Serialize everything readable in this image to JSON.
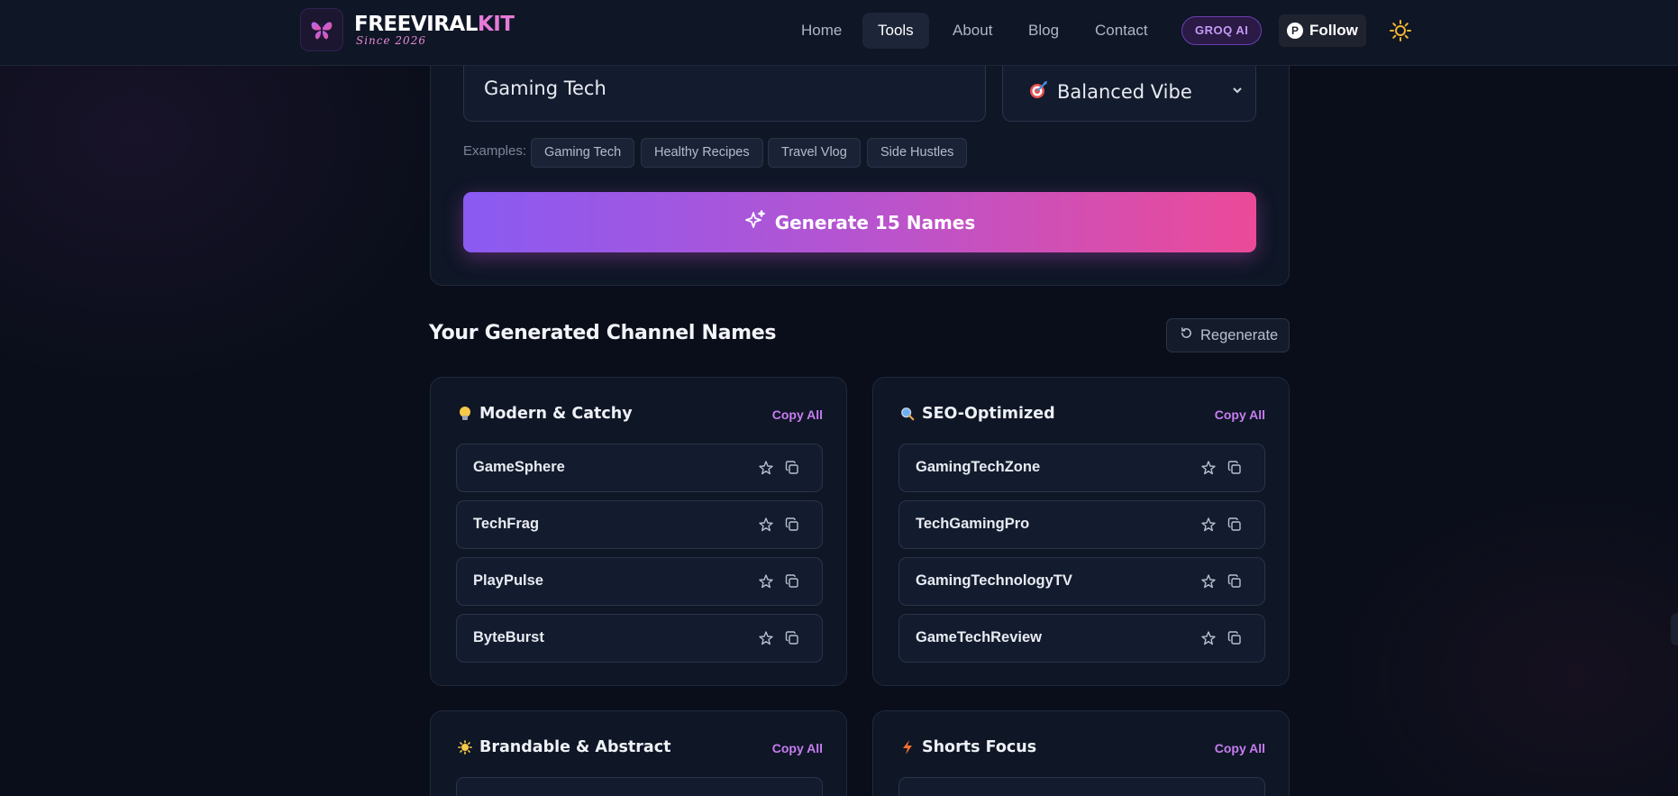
{
  "header": {
    "brand_main": "FREEVIRAL",
    "brand_accent": "KIT",
    "since": "Since 2026",
    "nav": [
      {
        "label": "Home"
      },
      {
        "label": "Tools"
      },
      {
        "label": "About"
      },
      {
        "label": "Blog"
      },
      {
        "label": "Contact"
      }
    ],
    "groq_badge": "GROQ AI",
    "follow_label": "Follow",
    "theme_icon": "sun-icon"
  },
  "form": {
    "topic_value": "Gaming Tech",
    "vibe_value": "Balanced Vibe",
    "vibe_icon": "dart-target-icon",
    "examples_label": "Examples:",
    "examples": [
      "Gaming Tech",
      "Healthy Recipes",
      "Travel Vlog",
      "Side Hustles"
    ],
    "generate_label": "Generate 15 Names"
  },
  "results": {
    "title": "Your Generated Channel Names",
    "regenerate_label": "Regenerate",
    "copy_all_label": "Copy All",
    "categories": [
      {
        "title": "Modern & Catchy",
        "icon": "lightbulb-icon",
        "names": [
          "GameSphere",
          "TechFrag",
          "PlayPulse",
          "ByteBurst"
        ]
      },
      {
        "title": "SEO-Optimized",
        "icon": "magnifier-icon",
        "names": [
          "GamingTechZone",
          "TechGamingPro",
          "GamingTechnologyTV",
          "GameTechReview"
        ]
      },
      {
        "title": "Brandable & Abstract",
        "icon": "sparkle-sun-icon",
        "names": []
      },
      {
        "title": "Shorts Focus",
        "icon": "lightning-icon",
        "names": []
      }
    ]
  },
  "colors": {
    "background": "#0a0e1a",
    "accent_purple": "#8a5af2",
    "accent_pink": "#ec4a98",
    "copy_all": "#c77df0"
  }
}
